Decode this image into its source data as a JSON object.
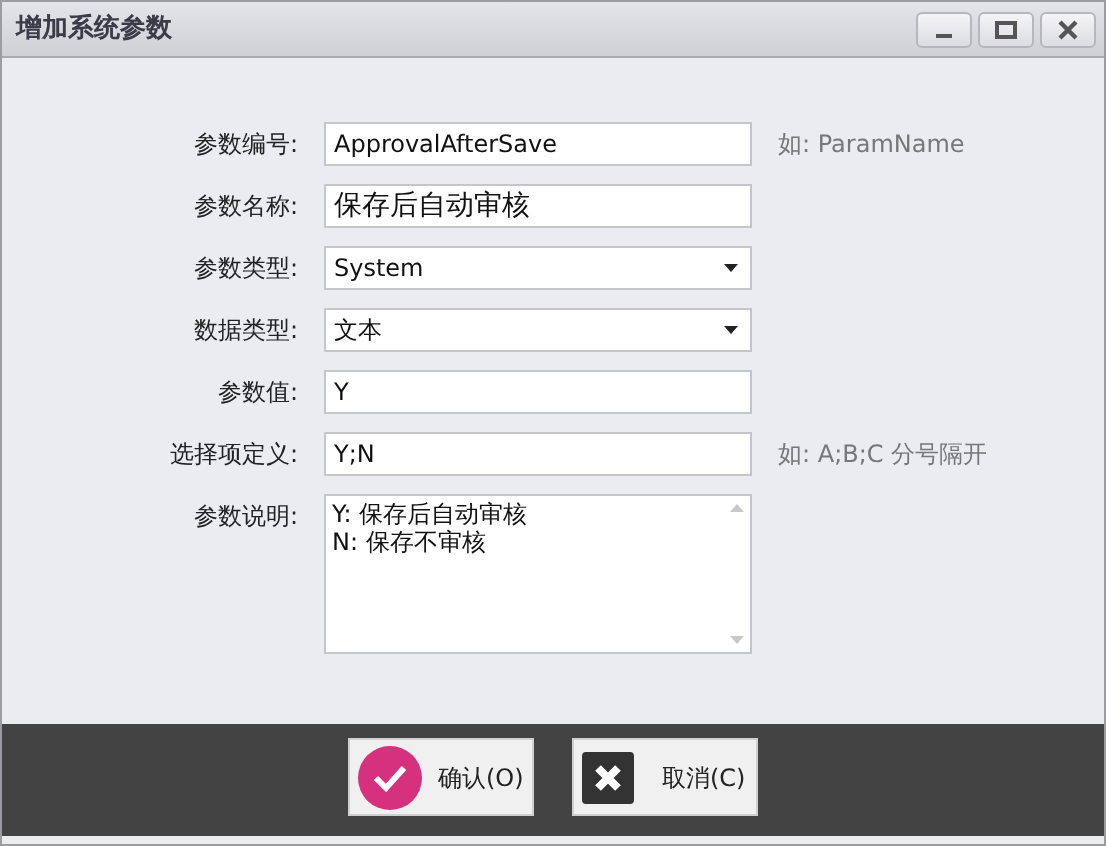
{
  "window": {
    "title": "增加系统参数",
    "controls": [
      {
        "kind": "minimize"
      },
      {
        "kind": "maximize"
      },
      {
        "kind": "close"
      }
    ]
  },
  "fields": [
    {
      "kind": "text",
      "label": "参数编号:",
      "value": "ApprovalAfterSave",
      "hint": "如: ParamName"
    },
    {
      "kind": "text",
      "label": "参数名称:",
      "value": "保存后自动审核",
      "large": true
    },
    {
      "kind": "select",
      "label": "参数类型:",
      "value": "System"
    },
    {
      "kind": "select",
      "label": "数据类型:",
      "value": "文本"
    },
    {
      "kind": "text",
      "label": "参数值:",
      "value": "Y"
    },
    {
      "kind": "text",
      "label": "选择项定义:",
      "value": "Y;N",
      "hint": "如: A;B;C 分号隔开"
    },
    {
      "kind": "textarea",
      "label": "参数说明:",
      "value": "Y: 保存后自动审核\nN: 保存不审核"
    }
  ],
  "buttons": [
    {
      "kind": "confirm",
      "label": "确认(O)"
    },
    {
      "kind": "cancel",
      "label": "取消(C)"
    }
  ]
}
